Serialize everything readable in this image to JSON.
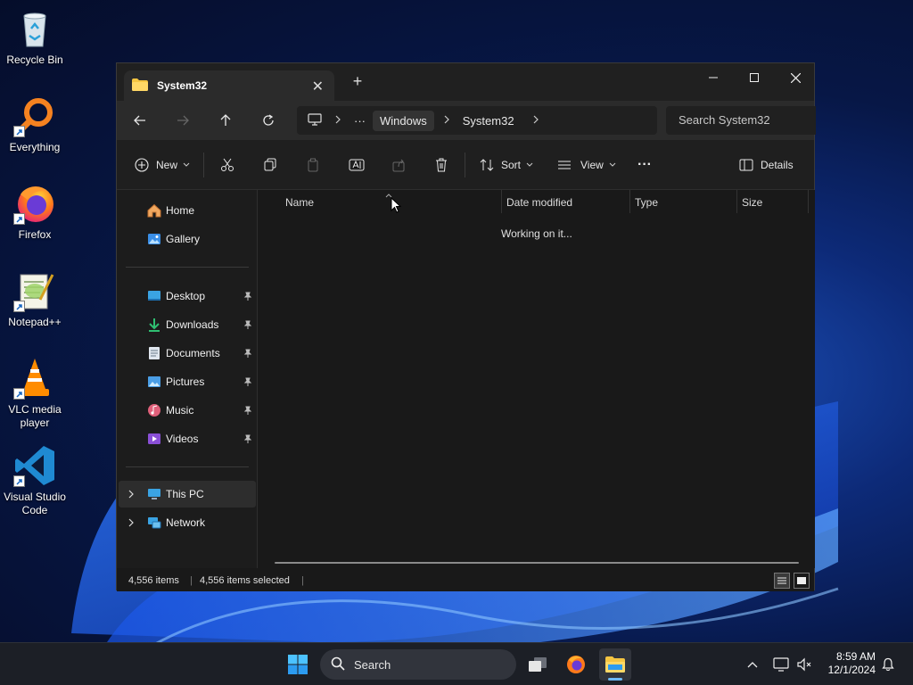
{
  "desktop": {
    "icons": [
      {
        "label": "Recycle Bin",
        "icon": "recycle-bin-icon"
      },
      {
        "label": "Everything",
        "icon": "everything-search-icon"
      },
      {
        "label": "Firefox",
        "icon": "firefox-icon"
      },
      {
        "label": "Notepad++",
        "icon": "notepadpp-icon"
      },
      {
        "label": "VLC media player",
        "icon": "vlc-icon"
      },
      {
        "label": "Visual Studio Code",
        "icon": "vscode-icon"
      }
    ]
  },
  "window": {
    "tab_title": "System32",
    "new_tab": "+",
    "address": {
      "more": "···",
      "crumbs": [
        "Windows",
        "System32"
      ]
    },
    "search_placeholder": "Search System32",
    "commands": {
      "new": "New",
      "sort": "Sort",
      "view": "View",
      "more": "···",
      "details": "Details"
    },
    "nav": {
      "home": "Home",
      "gallery": "Gallery",
      "quick_access": [
        "Desktop",
        "Downloads",
        "Documents",
        "Pictures",
        "Music",
        "Videos"
      ],
      "this_pc": "This PC",
      "network": "Network"
    },
    "columns": [
      "Name",
      "Date modified",
      "Type",
      "Size"
    ],
    "loading_text": "Working on it...",
    "status": {
      "items": "4,556 items",
      "selected": "4,556 items selected"
    }
  },
  "taskbar": {
    "search_label": "Search",
    "time": "8:59 AM",
    "date": "12/1/2024"
  },
  "colors": {
    "accent": "#6cb8f6",
    "window_bg": "#191919",
    "taskbar_bg": "#1c1f26"
  }
}
